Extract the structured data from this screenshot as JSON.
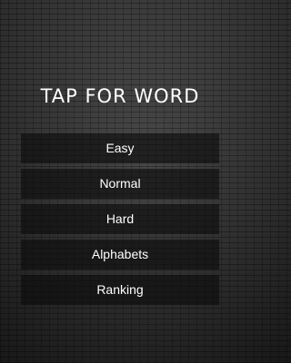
{
  "title": "TAP FOR WORD",
  "menu": {
    "easy": "Easy",
    "normal": "Normal",
    "hard": "Hard",
    "alphabets": "Alphabets",
    "ranking": "Ranking"
  }
}
